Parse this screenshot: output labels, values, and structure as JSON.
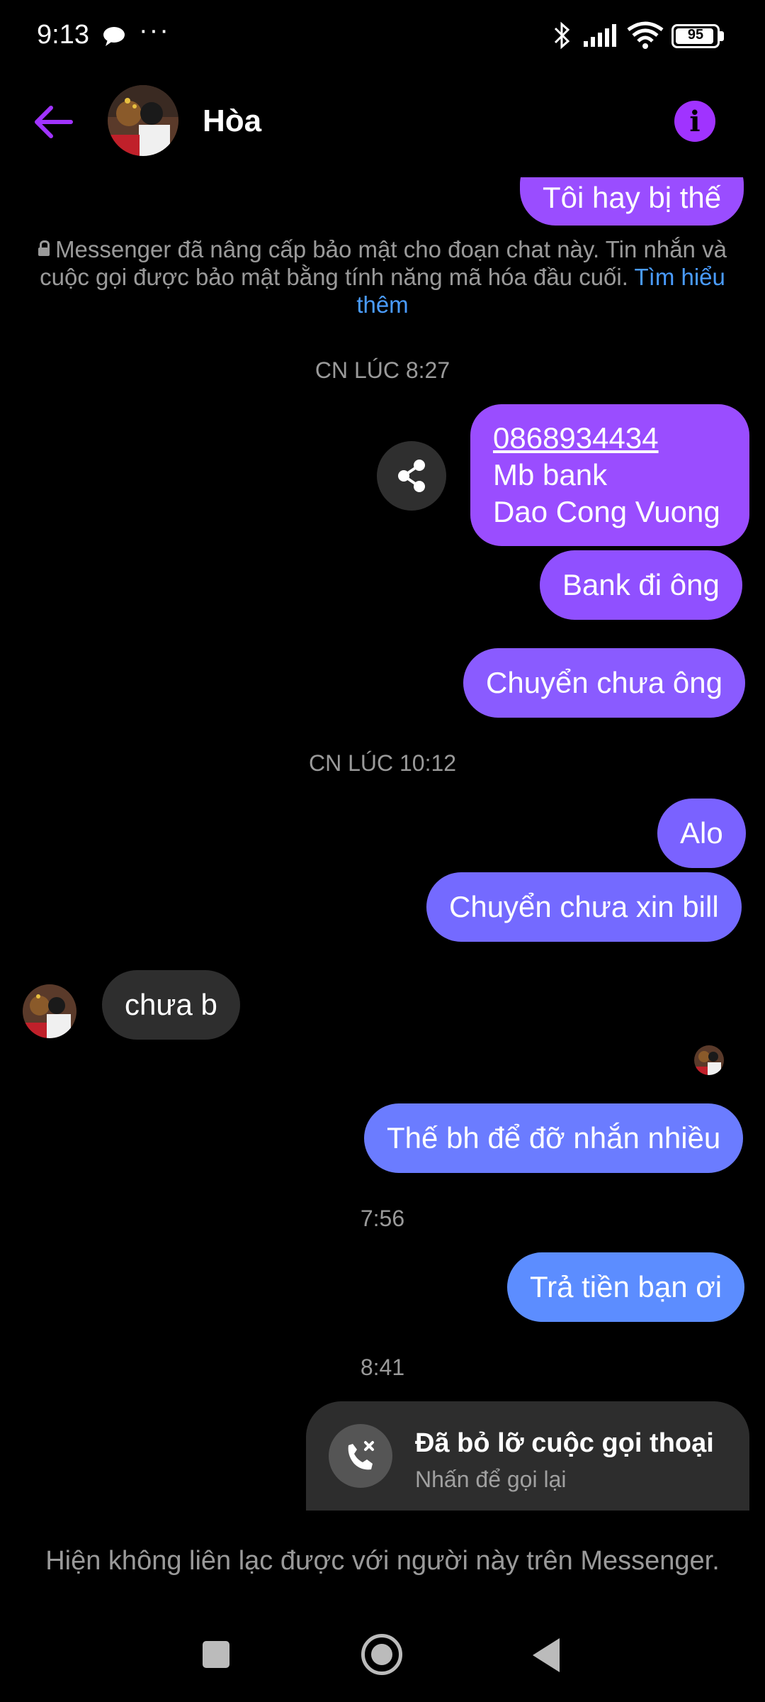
{
  "status_bar": {
    "time": "9:13",
    "more": "···",
    "battery": "95",
    "battery_level": 0.95,
    "icons": [
      "chat-notification-icon",
      "bluetooth-icon",
      "signal-icon",
      "wifi-icon",
      "battery-icon"
    ]
  },
  "header": {
    "contact_name": "Hòa",
    "back_icon": "arrow-left-icon",
    "info_icon": "info-icon",
    "accent_color": "#a033ff"
  },
  "chat": {
    "top_partial_message": "Tôi hay bị thế",
    "encryption_notice": {
      "text": "Messenger đã nâng cấp bảo mật cho đoạn chat này. Tin nhắn và cuộc gọi được bảo mật bằng tính năng mã hóa đầu cuối.",
      "link": "Tìm hiểu thêm"
    },
    "time_1": "CN LÚC 8:27",
    "bank_message": {
      "phone": "0868934434",
      "line2": "Mb bank",
      "line3": "Dao Cong Vuong"
    },
    "msg_bank_di_ong": "Bank đi ông",
    "msg_chuyen_chua_ong": "Chuyển chưa ông",
    "time_2": "CN LÚC 10:12",
    "msg_alo": "Alo",
    "msg_chuyen_chua_xin_bill": "Chuyển chưa xin bill",
    "incoming_msg": "chưa b",
    "msg_the_bh": "Thế bh để đỡ nhắn nhiều",
    "time_3": "7:56",
    "msg_tra_tien": "Trả tiền bạn ơi",
    "time_4": "8:41",
    "missed_call": {
      "title": "Đã bỏ lỡ cuộc gọi thoại",
      "subtitle": "Nhấn để gọi lại"
    }
  },
  "footer": {
    "unavailable_text": "Hiện không liên lạc được với người này trên Messenger."
  },
  "colors": {
    "bubble_purple": "#9a4dff",
    "bubble_violet": "#8a5bff",
    "bubble_indigo": "#6b7cff",
    "bubble_blue": "#5c8dff",
    "incoming_bubble": "#2e2e2e",
    "link_blue": "#4a9cff"
  }
}
